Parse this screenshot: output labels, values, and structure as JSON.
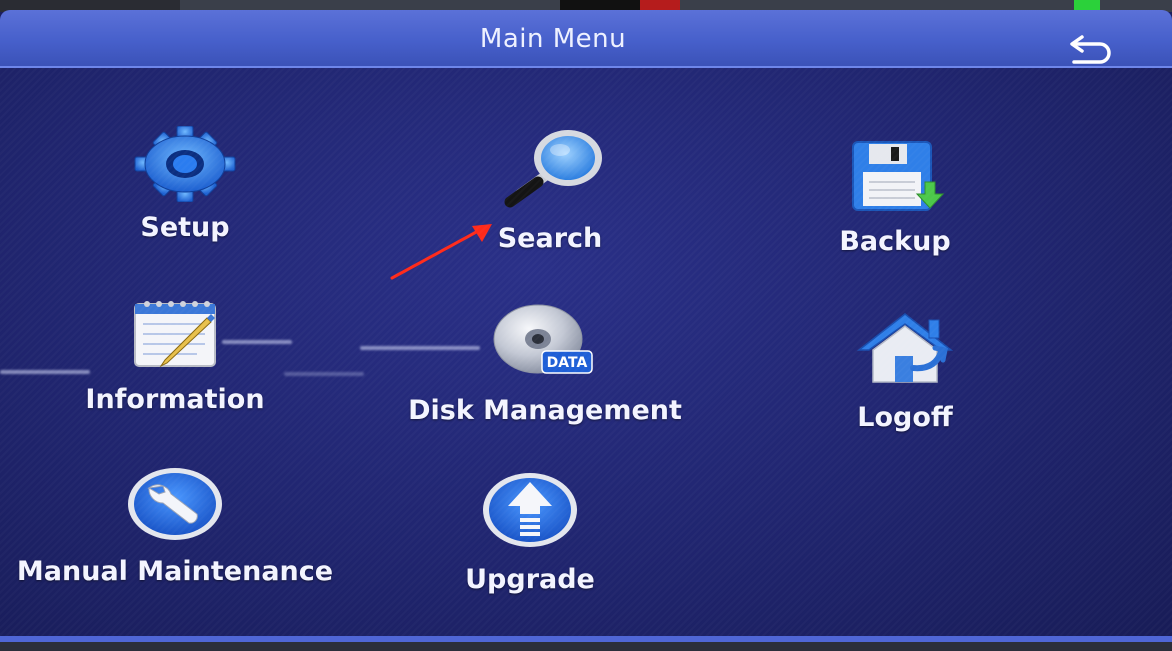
{
  "window": {
    "title": "Main Menu",
    "back_icon": "return-arrow-icon"
  },
  "menu": {
    "items": [
      {
        "label": "Setup",
        "icon": "gear-icon"
      },
      {
        "label": "Search",
        "icon": "magnifier-icon"
      },
      {
        "label": "Backup",
        "icon": "floppy-disk-icon"
      },
      {
        "label": "Information",
        "icon": "notepad-icon"
      },
      {
        "label": "Disk Management",
        "icon": "data-disc-icon",
        "icon_text": "DATA"
      },
      {
        "label": "Logoff",
        "icon": "house-icon"
      },
      {
        "label": "Manual Maintenance",
        "icon": "wrench-icon"
      },
      {
        "label": "Upgrade",
        "icon": "upload-arrow-icon"
      }
    ]
  },
  "annotation": {
    "icon": "red-pointer-arrow-icon",
    "target": "Search"
  },
  "colors": {
    "titlebar": "#4760cb",
    "panel": "#20256f",
    "text": "#f3f4ff",
    "accent_blue": "#2f7fe8",
    "annotation_red": "#ff2a1a"
  }
}
